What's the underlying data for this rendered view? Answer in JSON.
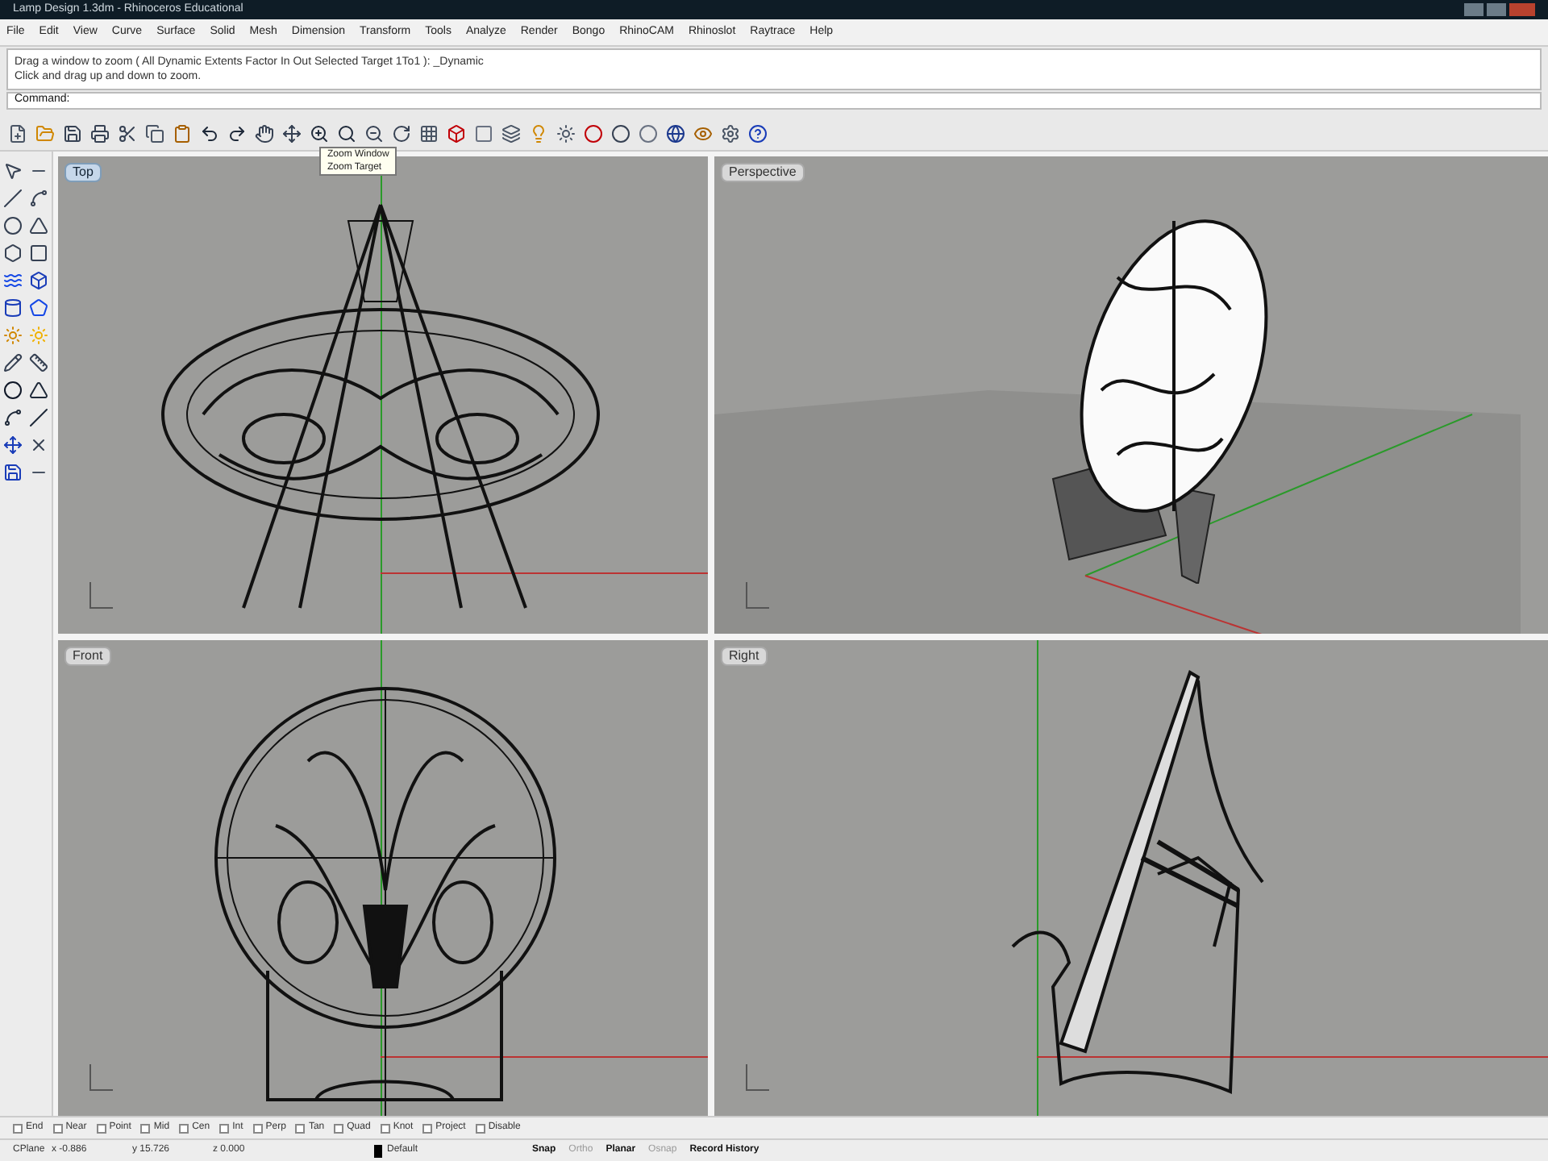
{
  "window": {
    "title": "Lamp Design 1.3dm - Rhinoceros Educational"
  },
  "menu": [
    "File",
    "Edit",
    "View",
    "Curve",
    "Surface",
    "Solid",
    "Mesh",
    "Dimension",
    "Transform",
    "Tools",
    "Analyze",
    "Render",
    "Bongo",
    "RhinoCAM",
    "Rhinoslot",
    "Raytrace",
    "Help"
  ],
  "command_history": [
    "Drag a window to zoom ( All  Dynamic  Extents  Factor  In  Out  Selected  Target  1To1 ): _Dynamic",
    "Click and drag up and down to zoom."
  ],
  "command_prompt": "Command:",
  "tooltip": [
    "Zoom Window",
    "Zoom Target"
  ],
  "viewports": [
    {
      "label": "Top",
      "kind": "top",
      "active": true
    },
    {
      "label": "Perspective",
      "kind": "perspective",
      "active": false
    },
    {
      "label": "Front",
      "kind": "front",
      "active": false
    },
    {
      "label": "Right",
      "kind": "right",
      "active": false
    }
  ],
  "osnaps": [
    {
      "label": "End",
      "checked": false
    },
    {
      "label": "Near",
      "checked": false
    },
    {
      "label": "Point",
      "checked": false
    },
    {
      "label": "Mid",
      "checked": false
    },
    {
      "label": "Cen",
      "checked": false
    },
    {
      "label": "Int",
      "checked": false
    },
    {
      "label": "Perp",
      "checked": false
    },
    {
      "label": "Tan",
      "checked": false
    },
    {
      "label": "Quad",
      "checked": false
    },
    {
      "label": "Knot",
      "checked": false
    },
    {
      "label": "Project",
      "checked": false
    },
    {
      "label": "Disable",
      "checked": false
    }
  ],
  "status_bar": {
    "cplane": "CPlane",
    "x": "x -0.886",
    "y": "y 15.726",
    "z": "z 0.000",
    "layer": "Default",
    "toggles": [
      {
        "label": "Snap",
        "on": true
      },
      {
        "label": "Ortho",
        "on": false
      },
      {
        "label": "Planar",
        "on": true
      },
      {
        "label": "Osnap",
        "on": false
      },
      {
        "label": "Record History",
        "on": true
      }
    ]
  }
}
